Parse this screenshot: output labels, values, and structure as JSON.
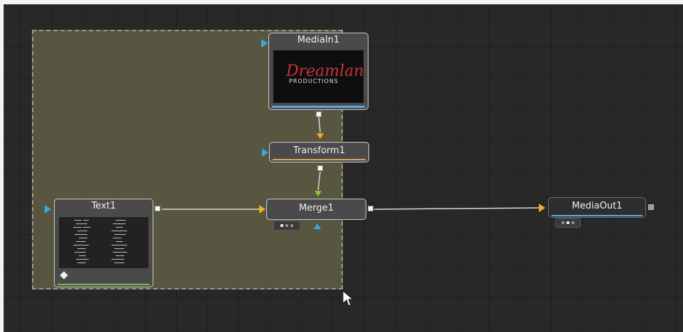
{
  "colors": {
    "background": "#282828",
    "selection_fill": "#807c54",
    "input_port_blue": "#3aa8d8",
    "input_port_yellow": "#e8b21c",
    "input_port_green": "#8ac23c",
    "media_in_bar": "#57a9e0",
    "transform_bar": "#d6a45e",
    "text_bar": "#7aba3c",
    "media_out_bar": "#57a9e0"
  },
  "nodes": {
    "media_in": {
      "title": "MediaIn1",
      "thumbnail": {
        "logo_line1": "Dreamland",
        "logo_line2": "PRODUCTIONS"
      }
    },
    "transform": {
      "title": "Transform1"
    },
    "text": {
      "title": "Text1",
      "tool_icon": "text-tool-icon"
    },
    "merge": {
      "title": "Merge1"
    },
    "media_out": {
      "title": "MediaOut1"
    }
  },
  "connections": [
    {
      "from": "MediaIn1",
      "to": "Transform1"
    },
    {
      "from": "Transform1",
      "to": "Merge1"
    },
    {
      "from": "Text1",
      "to": "Merge1"
    },
    {
      "from": "Merge1",
      "to": "MediaOut1"
    }
  ],
  "cursor": "arrow-cursor-icon"
}
